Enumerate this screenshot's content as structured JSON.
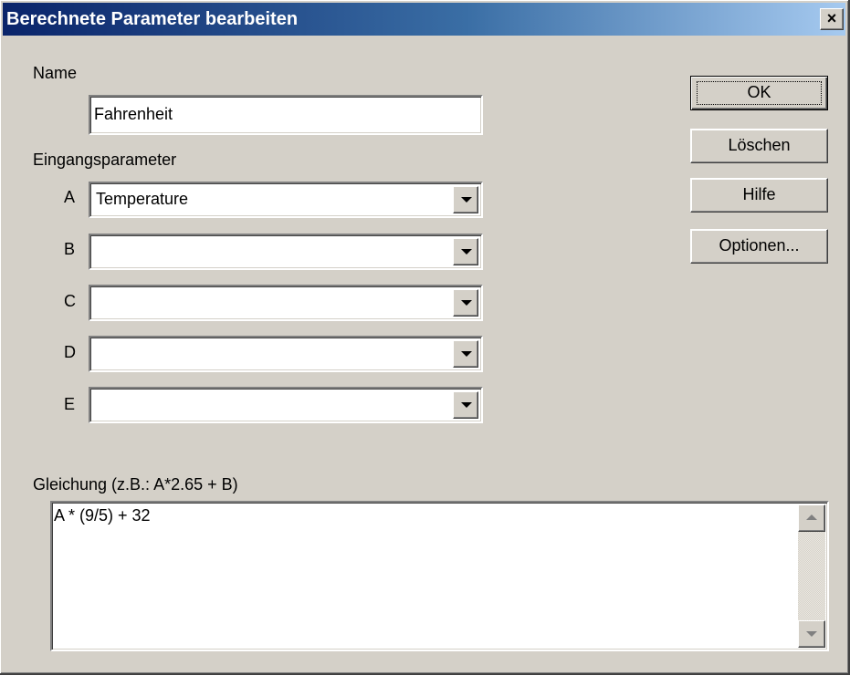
{
  "window": {
    "title": "Berechnete Parameter bearbeiten",
    "close_label": "×"
  },
  "name_section": {
    "label": "Name",
    "value": "Fahrenheit"
  },
  "inputs_section": {
    "label": "Eingangsparameter",
    "params": [
      {
        "letter": "A",
        "value": "Temperature"
      },
      {
        "letter": "B",
        "value": ""
      },
      {
        "letter": "C",
        "value": ""
      },
      {
        "letter": "D",
        "value": ""
      },
      {
        "letter": "E",
        "value": ""
      }
    ]
  },
  "equation_section": {
    "label": "Gleichung (z.B.:  A*2.65 + B)",
    "value": "A * (9/5) + 32"
  },
  "buttons": {
    "ok": "OK",
    "delete": "Löschen",
    "help": "Hilfe",
    "options": "Optionen..."
  },
  "colors": {
    "face": "#d4d0c8",
    "title_start": "#0a246a",
    "title_end": "#a6caf0"
  }
}
